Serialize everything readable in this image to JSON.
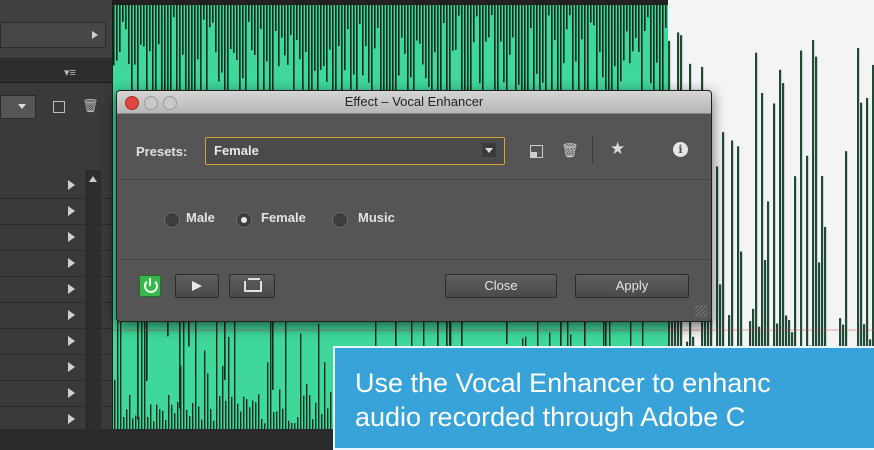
{
  "dialog": {
    "title": "Effect – Vocal Enhancer",
    "presets_label": "Presets:",
    "preset_value": "Female",
    "modes": [
      {
        "label": "Male",
        "selected": false
      },
      {
        "label": "Female",
        "selected": true
      },
      {
        "label": "Music",
        "selected": false
      }
    ],
    "close_label": "Close",
    "apply_label": "Apply",
    "power_on": true
  },
  "caption": {
    "line1": "Use the Vocal Enhancer to enhanc",
    "line2": "audio recorded through Adobe C"
  },
  "colors": {
    "waveform_green": "#3fd89a",
    "caption_blue": "#37a3d9",
    "dialog_bg": "#555555",
    "power_green": "#38b84a"
  },
  "icons": [
    "chevron-right-icon",
    "menu-icon",
    "dropdown-arrow-icon",
    "save-preset-icon",
    "trash-icon",
    "star-icon",
    "info-icon",
    "power-icon",
    "play-icon",
    "export-icon"
  ]
}
